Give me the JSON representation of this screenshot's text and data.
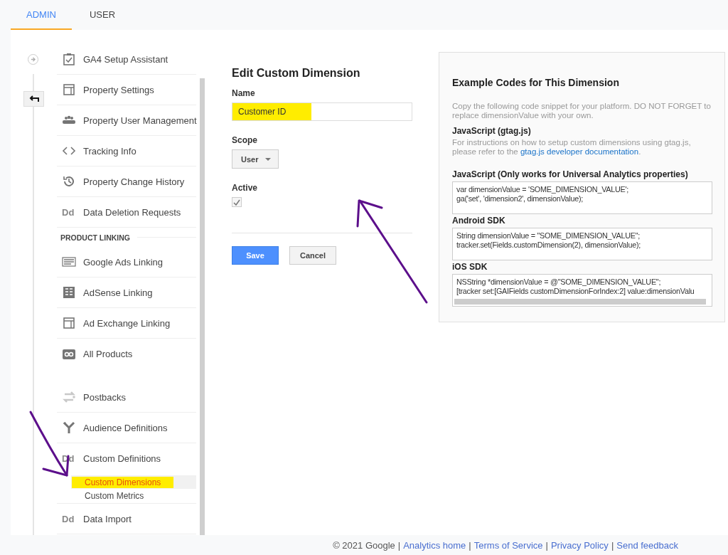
{
  "tabs": [
    {
      "label": "ADMIN",
      "selected": true
    },
    {
      "label": "USER",
      "selected": false
    }
  ],
  "sidebar": {
    "sections": [
      {
        "items": [
          {
            "label": "GA4 Setup Assistant"
          },
          {
            "label": "Property Settings"
          },
          {
            "label": "Property User Management"
          },
          {
            "label": "Tracking Info"
          },
          {
            "label": "Property Change History"
          },
          {
            "label": "Data Deletion Requests",
            "icon_text": "Dd"
          }
        ]
      },
      {
        "heading": "PRODUCT LINKING",
        "items": [
          {
            "label": "Google Ads Linking"
          },
          {
            "label": "AdSense Linking"
          },
          {
            "label": "Ad Exchange Linking"
          },
          {
            "label": "All Products"
          }
        ]
      },
      {
        "items": [
          {
            "label": "Postbacks"
          },
          {
            "label": "Audience Definitions"
          },
          {
            "label": "Custom Definitions",
            "icon_text": "Dd",
            "children": [
              {
                "label": "Custom Dimensions",
                "selected": true,
                "highlighted": true
              },
              {
                "label": "Custom Metrics",
                "selected": false,
                "highlighted": false
              }
            ]
          },
          {
            "label": "Data Import",
            "icon_text": "Dd"
          }
        ]
      }
    ]
  },
  "form": {
    "title": "Edit Custom Dimension",
    "name_label": "Name",
    "name_value": "Customer ID",
    "name_highlighted": true,
    "scope_label": "Scope",
    "scope_value": "User",
    "active_label": "Active",
    "active_checked": true,
    "save": "Save",
    "cancel": "Cancel"
  },
  "examples": {
    "title": "Example Codes for This Dimension",
    "intro": "Copy the following code snippet for your platform. DO NOT FORGET to replace dimensionValue with your own.",
    "gtag_heading": "JavaScript (gtag.js)",
    "gtag_text": "For instructions on how to setup custom dimensions using gtag.js, please refer to the",
    "gtag_link": "gtag.js developer documentation",
    "gtag_end": ".",
    "snippets": [
      {
        "heading": "JavaScript (Only works for Universal Analytics properties)",
        "lines": [
          "var dimensionValue = 'SOME_DIMENSION_VALUE';",
          "ga('set', 'dimension2', dimensionValue);"
        ],
        "scrollbar": false
      },
      {
        "heading": "Android SDK",
        "lines": [
          "String dimensionValue = \"SOME_DIMENSION_VALUE\";",
          "tracker.set(Fields.customDimension(2), dimensionValue);"
        ],
        "scrollbar": false
      },
      {
        "heading": "iOS SDK",
        "lines": [
          "NSString *dimensionValue = @\"SOME_DIMENSION_VALUE\";",
          "[tracker set:[GAIFields customDimensionForIndex:2] value:dimensionValu"
        ],
        "scrollbar": true
      }
    ]
  },
  "footer": {
    "parts": [
      {
        "kind": "text",
        "text": "© 2021 Google"
      },
      {
        "kind": "separator",
        "text": "|"
      },
      {
        "kind": "link",
        "text": "Analytics home"
      },
      {
        "kind": "separator",
        "text": "|"
      },
      {
        "kind": "link",
        "text": "Terms of Service"
      },
      {
        "kind": "separator",
        "text": "|"
      },
      {
        "kind": "link",
        "text": "Privacy Policy"
      },
      {
        "kind": "separator",
        "text": "|"
      },
      {
        "kind": "link",
        "text": "Send feedback"
      }
    ]
  }
}
